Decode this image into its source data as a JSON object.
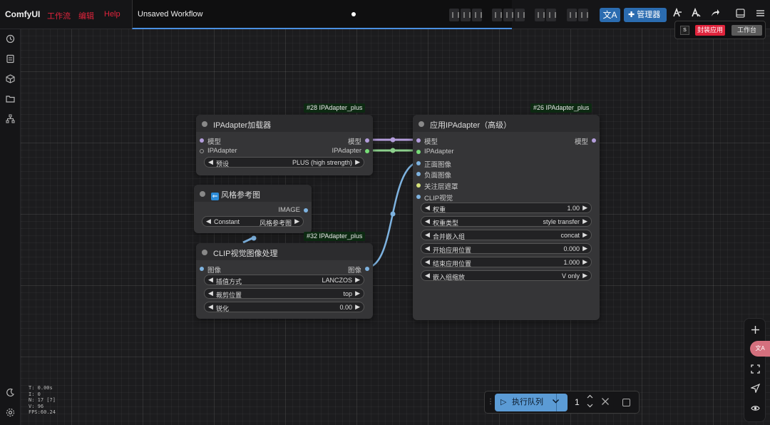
{
  "topbar": {
    "app_title": "ComfyUI",
    "menu": [
      "工作流",
      "编辑",
      "Help"
    ],
    "workflow_tab_title": "Unsaved Workflow",
    "manager_label": "管理器",
    "lang_label": "文A"
  },
  "popup": {
    "logo": "S",
    "red_label": "封装应用",
    "gray_label": "工作台"
  },
  "stats": {
    "t": "T: 0.00s",
    "i": "I: 0",
    "n": "N: 17 [7]",
    "v": "V: 96",
    "fps": "FPS:60.24"
  },
  "nodes": {
    "loader": {
      "badge": "#28 IPAdapter_plus",
      "title": "IPAdapter加载器",
      "in_model": "模型",
      "in_ipadapter": "IPAdapter",
      "out_model": "模型",
      "out_ipadapter": "IPAdapter",
      "w_preset_label": "预设",
      "w_preset_value": "PLUS (high strength)"
    },
    "style_ref": {
      "title": "风格参考图",
      "out_image": "IMAGE",
      "w_label": "Constant",
      "w_value": "风格参考图"
    },
    "clip_vision": {
      "badge": "#32 IPAdapter_plus",
      "title": "CLIP视觉图像处理",
      "in_image": "图像",
      "out_image": "图像",
      "widgets": [
        {
          "label": "插值方式",
          "value": "LANCZOS"
        },
        {
          "label": "裁剪位置",
          "value": "top"
        },
        {
          "label": "锐化",
          "value": "0.00"
        }
      ]
    },
    "apply": {
      "badge": "#26 IPAdapter_plus",
      "title": "应用IPAdapter（高级）",
      "out_model": "模型",
      "inputs": [
        "模型",
        "IPAdapter",
        "正面图像",
        "负面图像",
        "关注层遮罩",
        "CLIP视觉"
      ],
      "widgets": [
        {
          "label": "权重",
          "value": "1.00"
        },
        {
          "label": "权重类型",
          "value": "style transfer"
        },
        {
          "label": "合并嵌入组",
          "value": "concat"
        },
        {
          "label": "开始应用位置",
          "value": "0.000"
        },
        {
          "label": "结束应用位置",
          "value": "1.000"
        },
        {
          "label": "嵌入组缩放",
          "value": "V only"
        }
      ]
    }
  },
  "queue": {
    "run_label": "执行队列",
    "count": "1"
  },
  "colors": {
    "accent_blue": "#2b6cb0",
    "menu_red": "#e0243c",
    "wire_model": "#b39ddb",
    "wire_ipadapter": "#77dd77",
    "wire_image": "#7eb3e0",
    "node_bg": "#353537",
    "canvas_bg": "#1c1c1e"
  }
}
